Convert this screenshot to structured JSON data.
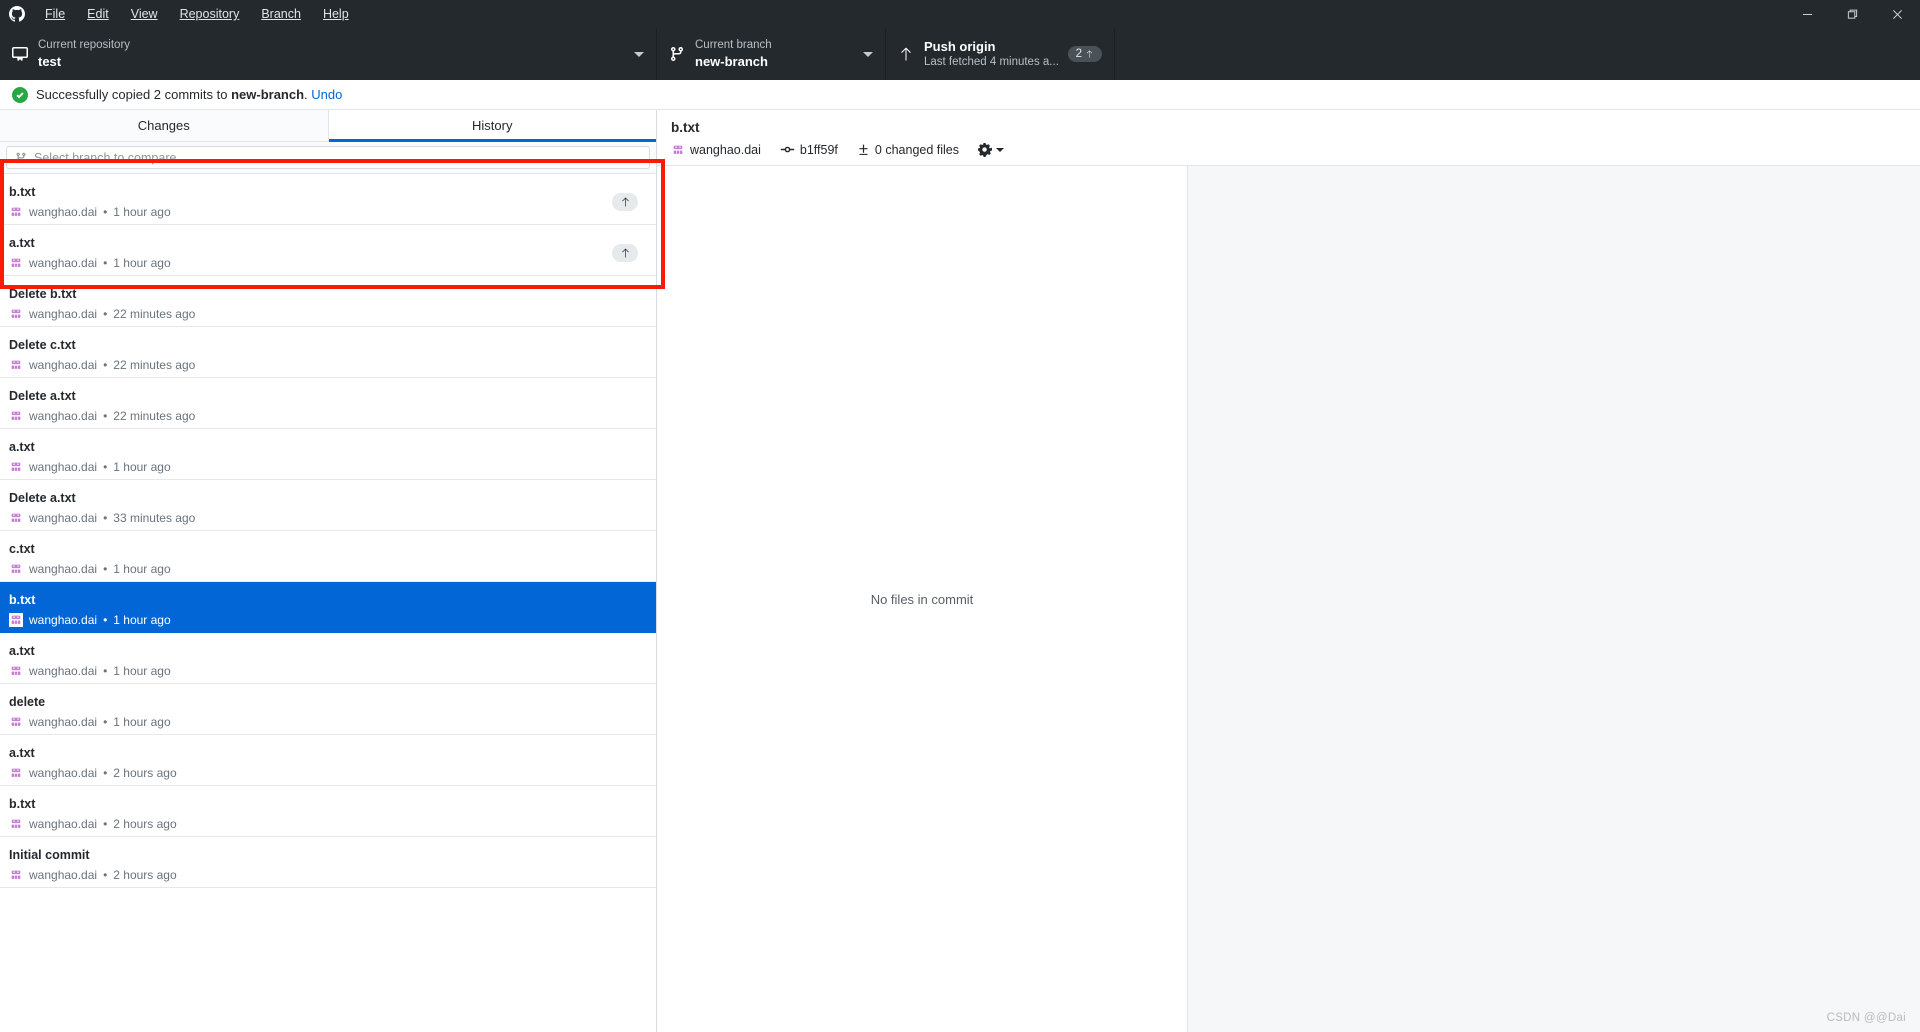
{
  "app": {
    "logo_icon": "github-mark-icon",
    "menu": [
      {
        "label": "File",
        "accel": "F"
      },
      {
        "label": "Edit",
        "accel": "E"
      },
      {
        "label": "View",
        "accel": "V"
      },
      {
        "label": "Repository",
        "accel": "R"
      },
      {
        "label": "Branch",
        "accel": "B"
      },
      {
        "label": "Help",
        "accel": "H"
      }
    ],
    "window_controls": {
      "minimize": "minimize-icon",
      "maximize": "maximize-icon",
      "close": "close-icon"
    }
  },
  "toolbar": {
    "repository": {
      "label": "Current repository",
      "value": "test",
      "icon": "repo-icon"
    },
    "branch": {
      "label": "Current branch",
      "value": "new-branch",
      "icon": "branch-icon"
    },
    "push": {
      "label": "Push origin",
      "sub": "Last fetched 4 minutes a...",
      "icon": "arrow-up-icon",
      "badge_count": "2"
    }
  },
  "banner": {
    "icon": "success-check-icon",
    "text_before": "Successfully copied 2 commits to ",
    "branch": "new-branch",
    "text_after": ".",
    "undo_label": "Undo"
  },
  "sidebar": {
    "tabs": [
      {
        "label": "Changes",
        "active": false
      },
      {
        "label": "History",
        "active": true
      }
    ],
    "compare": {
      "icon": "compare-branch-icon",
      "placeholder": "Select branch to compare..."
    },
    "commits": [
      {
        "title": "b.txt",
        "author": "wanghao.dai",
        "time": "1 hour ago",
        "unpushed": true,
        "selected": false
      },
      {
        "title": "a.txt",
        "author": "wanghao.dai",
        "time": "1 hour ago",
        "unpushed": true,
        "selected": false
      },
      {
        "title": "Delete b.txt",
        "author": "wanghao.dai",
        "time": "22 minutes ago",
        "unpushed": false,
        "selected": false
      },
      {
        "title": "Delete c.txt",
        "author": "wanghao.dai",
        "time": "22 minutes ago",
        "unpushed": false,
        "selected": false
      },
      {
        "title": "Delete a.txt",
        "author": "wanghao.dai",
        "time": "22 minutes ago",
        "unpushed": false,
        "selected": false
      },
      {
        "title": "a.txt",
        "author": "wanghao.dai",
        "time": "1 hour ago",
        "unpushed": false,
        "selected": false
      },
      {
        "title": "Delete a.txt",
        "author": "wanghao.dai",
        "time": "33 minutes ago",
        "unpushed": false,
        "selected": false
      },
      {
        "title": "c.txt",
        "author": "wanghao.dai",
        "time": "1 hour ago",
        "unpushed": false,
        "selected": false
      },
      {
        "title": "b.txt",
        "author": "wanghao.dai",
        "time": "1 hour ago",
        "unpushed": false,
        "selected": true
      },
      {
        "title": "a.txt",
        "author": "wanghao.dai",
        "time": "1 hour ago",
        "unpushed": false,
        "selected": false
      },
      {
        "title": "delete",
        "author": "wanghao.dai",
        "time": "1 hour ago",
        "unpushed": false,
        "selected": false
      },
      {
        "title": "a.txt",
        "author": "wanghao.dai",
        "time": "2 hours ago",
        "unpushed": false,
        "selected": false
      },
      {
        "title": "b.txt",
        "author": "wanghao.dai",
        "time": "2 hours ago",
        "unpushed": false,
        "selected": false
      },
      {
        "title": "Initial commit",
        "author": "wanghao.dai",
        "time": "2 hours ago",
        "unpushed": false,
        "selected": false
      }
    ]
  },
  "detail": {
    "title": "b.txt",
    "author": "wanghao.dai",
    "sha": "b1ff59f",
    "changed_files": "0 changed files",
    "gear_icon": "gear-icon",
    "empty_message": "No files in commit"
  },
  "watermark": "CSDN @@Dai",
  "colors": {
    "chrome": "#24292e",
    "accent": "#0366d6",
    "success": "#28a745",
    "highlight_box": "#fb1a06",
    "selected_row": "#0366d6"
  }
}
